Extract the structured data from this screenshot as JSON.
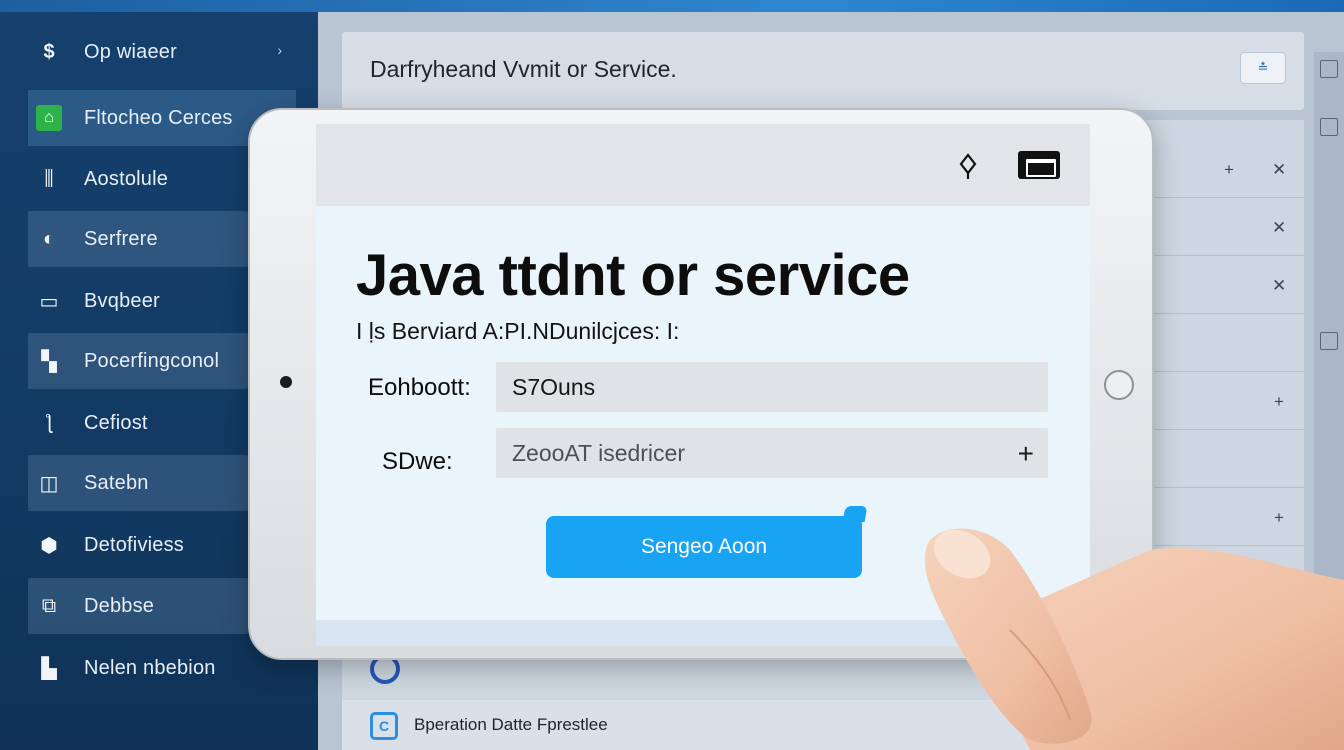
{
  "sidebar": {
    "items": [
      {
        "label": "Op wiaeer",
        "icon": "dollar-s-icon"
      },
      {
        "label": "Fltocheo Cerces",
        "icon": "flask-icon"
      },
      {
        "label": "Aostolule",
        "icon": "pillars-icon"
      },
      {
        "label": "Serfrere",
        "icon": "globe-icon"
      },
      {
        "label": "Bvqbeer",
        "icon": "monitor-icon"
      },
      {
        "label": "Pocerfingconol",
        "icon": "grid-icon"
      },
      {
        "label": "Cefiost",
        "icon": "wrench-icon"
      },
      {
        "label": "Satebn",
        "icon": "book-icon"
      },
      {
        "label": "Detofiviess",
        "icon": "home-icon"
      },
      {
        "label": "Debbse",
        "icon": "document-icon"
      },
      {
        "label": "Nelen nbebion",
        "icon": "bars-icon"
      }
    ]
  },
  "main": {
    "title": "Darfryheand Vvmit or Service.",
    "header_button": "≛",
    "bottom_label": "Bperation Datte Fprestlee"
  },
  "tablet": {
    "title": "Java ttdnt or service",
    "subtitle": "I ḷs Berviard A:PI.NDunilcjces: I:",
    "field1_label": "Eohboott:",
    "field1_value": "S7Ouns",
    "field2_label": "SDwe:",
    "field2_placeholder": "ZeooAT isedricer",
    "submit_label": "Sengeo Aoon"
  },
  "colors": {
    "sidebar_bg": "#16406d",
    "accent_green": "#2db34a",
    "submit_blue": "#19a3f3"
  }
}
